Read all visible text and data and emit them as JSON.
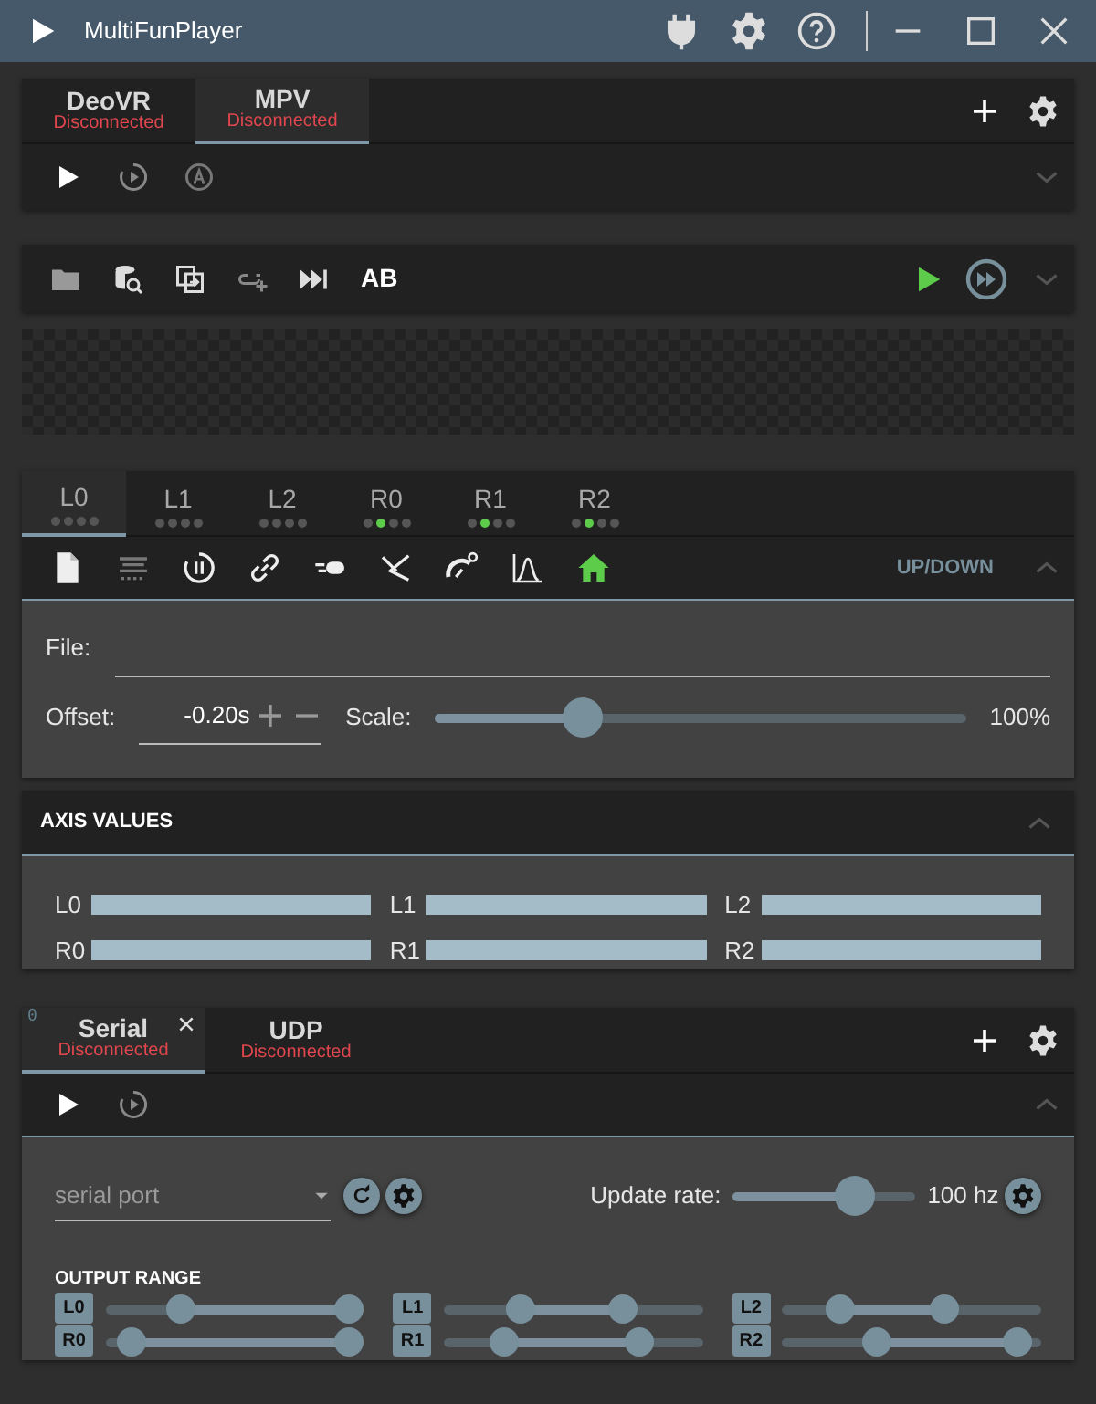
{
  "window": {
    "title": "MultiFunPlayer"
  },
  "video_players": {
    "tabs": [
      {
        "name": "DeoVR",
        "status": "Disconnected",
        "selected": false
      },
      {
        "name": "MPV",
        "status": "Disconnected",
        "selected": true
      }
    ]
  },
  "media": {
    "ab_label": "AB"
  },
  "axes": {
    "tabs": [
      {
        "label": "L0",
        "selected": true,
        "dots": [
          {
            "on": false
          },
          {
            "on": false
          },
          {
            "on": false
          },
          {
            "on": false
          }
        ]
      },
      {
        "label": "L1",
        "selected": false,
        "dots": [
          {
            "on": false
          },
          {
            "on": false
          },
          {
            "on": false
          },
          {
            "on": false
          }
        ]
      },
      {
        "label": "L2",
        "selected": false,
        "dots": [
          {
            "on": false
          },
          {
            "on": false
          },
          {
            "on": false
          },
          {
            "on": false
          }
        ]
      },
      {
        "label": "R0",
        "selected": false,
        "dots": [
          {
            "on": false
          },
          {
            "on": true
          },
          {
            "on": false
          },
          {
            "on": false
          }
        ]
      },
      {
        "label": "R1",
        "selected": false,
        "dots": [
          {
            "on": false
          },
          {
            "on": true
          },
          {
            "on": false
          },
          {
            "on": false
          }
        ]
      },
      {
        "label": "R2",
        "selected": false,
        "dots": [
          {
            "on": false
          },
          {
            "on": true
          },
          {
            "on": false
          },
          {
            "on": false
          }
        ]
      }
    ],
    "motion_label": "UP/DOWN",
    "file_label": "File:",
    "offset_label": "Offset:",
    "offset_value": "-0.20s",
    "scale_label": "Scale:",
    "scale": {
      "level": 0.26
    },
    "scale_reading": "100%"
  },
  "axis_values": {
    "title": "AXIS VALUES",
    "items": [
      {
        "label": "L0",
        "level": 1
      },
      {
        "label": "L1",
        "level": 1
      },
      {
        "label": "L2",
        "level": 1
      },
      {
        "label": "R0",
        "level": 1
      },
      {
        "label": "R1",
        "level": 1
      },
      {
        "label": "R2",
        "level": 1
      }
    ]
  },
  "outputs": {
    "tabs": [
      {
        "name": "Serial",
        "status": "Disconnected",
        "selected": true,
        "index_mark": "0",
        "closable": true
      },
      {
        "name": "UDP",
        "status": "Disconnected",
        "selected": false,
        "closable": false
      }
    ],
    "port_placeholder": "serial port",
    "update_rate_label": "Update rate:",
    "update_rate": {
      "level": 0.72
    },
    "update_rate_reading": "100 hz",
    "range_title": "OUTPUT RANGE",
    "ranges": [
      {
        "label": "L0",
        "thumbs": [
          {
            "level": 0.27
          },
          {
            "level": 1
          }
        ]
      },
      {
        "label": "L1",
        "thumbs": [
          {
            "level": 0.27
          },
          {
            "level": 0.72
          }
        ]
      },
      {
        "label": "L2",
        "thumbs": [
          {
            "level": 0.19
          },
          {
            "level": 0.64
          }
        ]
      },
      {
        "label": "R0",
        "thumbs": [
          {
            "level": 0.05
          },
          {
            "level": 1
          }
        ]
      },
      {
        "label": "R1",
        "thumbs": [
          {
            "level": 0.2
          },
          {
            "level": 0.79
          }
        ]
      },
      {
        "label": "R2",
        "thumbs": [
          {
            "level": 0.35
          },
          {
            "level": 0.96
          }
        ]
      }
    ]
  }
}
